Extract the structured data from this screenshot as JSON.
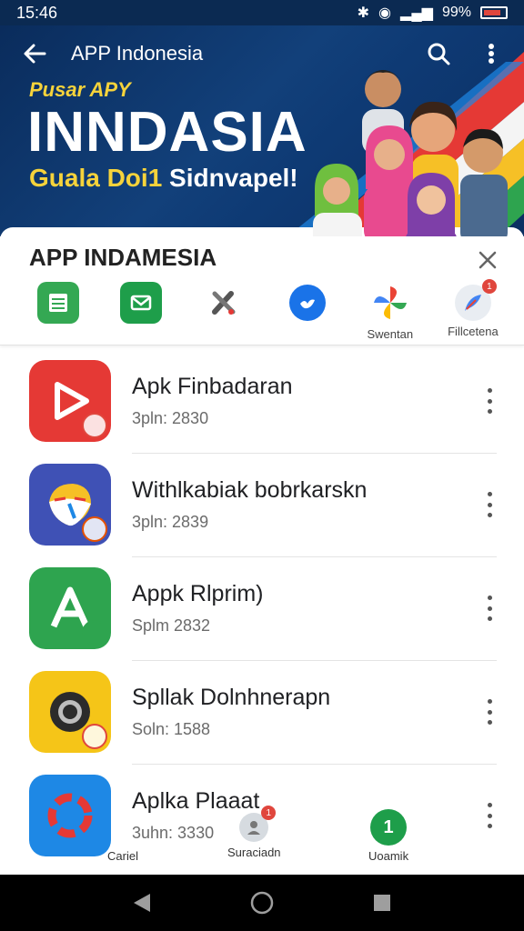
{
  "status_bar": {
    "time": "15:46",
    "battery_percent": "99%"
  },
  "app_bar": {
    "title": "APP Indonesia"
  },
  "hero": {
    "kicker": "Pusar APY",
    "title": "INNDASIA",
    "subtitle_a": "Guala Doi1",
    "subtitle_b": "Sidnvapel!"
  },
  "sheet": {
    "title": "APP INDAMESIA",
    "share_targets": [
      {
        "label": "",
        "icon": "sheets-icon",
        "color": "#34a853"
      },
      {
        "label": "",
        "icon": "mail-icon",
        "color": "#1e9e4a"
      },
      {
        "label": "",
        "icon": "tools-icon",
        "color": "#555555"
      },
      {
        "label": "",
        "icon": "bird-icon",
        "color": "#1a73e8"
      },
      {
        "label": "Swentan",
        "icon": "pinwheel-icon",
        "color": "#ea4335"
      },
      {
        "label": "Fillcetena",
        "icon": "feather-icon",
        "color": "#7a8aa0"
      }
    ],
    "badge_count": "1"
  },
  "apps": [
    {
      "name": "Apk Finbadaran",
      "meta": "3pln: 2830",
      "icon": "play-icon",
      "color": "#e53935"
    },
    {
      "name": "Withlkabiak bobrkarskn",
      "meta": "3pln: 2839",
      "icon": "face-icon",
      "color": "#3f51b5"
    },
    {
      "name": "Appk Rlprim)",
      "meta": "Splm 2832",
      "icon": "a-letter-icon",
      "color": "#2ea44f"
    },
    {
      "name": "Spllak Dolnhnerapn",
      "meta": "Soln: 1588",
      "icon": "camera-lens-icon",
      "color": "#f5c518"
    },
    {
      "name": "Aplka Plaaat",
      "meta": "3uhn: 3330",
      "icon": "ring-icon",
      "color": "#1e88e5"
    }
  ],
  "bottom_tabs": {
    "cancel": "Cariel",
    "search": "Suraciadn",
    "search_badge": "1",
    "download": "Uoamik",
    "download_number": "1"
  }
}
